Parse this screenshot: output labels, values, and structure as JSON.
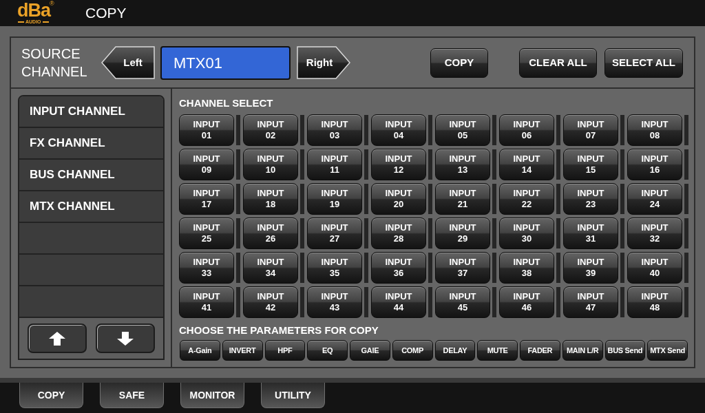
{
  "header": {
    "logo": {
      "text": "dBa",
      "mark": "®",
      "subtext": "AUDIO"
    },
    "title": "COPY"
  },
  "source": {
    "label": "SOURCE CHANNEL",
    "prev_button": "Left",
    "value": "MTX01",
    "next_button": "Right",
    "actions": [
      "COPY",
      "CLEAR ALL",
      "SELECT ALL"
    ]
  },
  "channel_types": [
    "INPUT CHANNEL",
    "FX CHANNEL",
    "BUS CHANNEL",
    "MTX CHANNEL"
  ],
  "channel_select": {
    "title": "CHANNEL SELECT",
    "channels": [
      {
        "label": "INPUT",
        "number": "01"
      },
      {
        "label": "INPUT",
        "number": "02"
      },
      {
        "label": "INPUT",
        "number": "03"
      },
      {
        "label": "INPUT",
        "number": "04"
      },
      {
        "label": "INPUT",
        "number": "05"
      },
      {
        "label": "INPUT",
        "number": "06"
      },
      {
        "label": "INPUT",
        "number": "07"
      },
      {
        "label": "INPUT",
        "number": "08"
      },
      {
        "label": "INPUT",
        "number": "09"
      },
      {
        "label": "INPUT",
        "number": "10"
      },
      {
        "label": "INPUT",
        "number": "11"
      },
      {
        "label": "INPUT",
        "number": "12"
      },
      {
        "label": "INPUT",
        "number": "13"
      },
      {
        "label": "INPUT",
        "number": "14"
      },
      {
        "label": "INPUT",
        "number": "15"
      },
      {
        "label": "INPUT",
        "number": "16"
      },
      {
        "label": "INPUT",
        "number": "17"
      },
      {
        "label": "INPUT",
        "number": "18"
      },
      {
        "label": "INPUT",
        "number": "19"
      },
      {
        "label": "INPUT",
        "number": "20"
      },
      {
        "label": "INPUT",
        "number": "21"
      },
      {
        "label": "INPUT",
        "number": "22"
      },
      {
        "label": "INPUT",
        "number": "23"
      },
      {
        "label": "INPUT",
        "number": "24"
      },
      {
        "label": "INPUT",
        "number": "25"
      },
      {
        "label": "INPUT",
        "number": "26"
      },
      {
        "label": "INPUT",
        "number": "27"
      },
      {
        "label": "INPUT",
        "number": "28"
      },
      {
        "label": "INPUT",
        "number": "29"
      },
      {
        "label": "INPUT",
        "number": "30"
      },
      {
        "label": "INPUT",
        "number": "31"
      },
      {
        "label": "INPUT",
        "number": "32"
      },
      {
        "label": "INPUT",
        "number": "33"
      },
      {
        "label": "INPUT",
        "number": "34"
      },
      {
        "label": "INPUT",
        "number": "35"
      },
      {
        "label": "INPUT",
        "number": "36"
      },
      {
        "label": "INPUT",
        "number": "37"
      },
      {
        "label": "INPUT",
        "number": "38"
      },
      {
        "label": "INPUT",
        "number": "39"
      },
      {
        "label": "INPUT",
        "number": "40"
      },
      {
        "label": "INPUT",
        "number": "41"
      },
      {
        "label": "INPUT",
        "number": "42"
      },
      {
        "label": "INPUT",
        "number": "43"
      },
      {
        "label": "INPUT",
        "number": "44"
      },
      {
        "label": "INPUT",
        "number": "45"
      },
      {
        "label": "INPUT",
        "number": "46"
      },
      {
        "label": "INPUT",
        "number": "47"
      },
      {
        "label": "INPUT",
        "number": "48"
      }
    ]
  },
  "parameters": {
    "title": "CHOOSE THE PARAMETERS FOR COPY",
    "items": [
      "A-Gain",
      "INVERT",
      "HPF",
      "EQ",
      "GAIE",
      "COMP",
      "DELAY",
      "MUTE",
      "FADER",
      "MAIN L/R",
      "BUS Send",
      "MTX Send"
    ]
  },
  "bottom_tabs": [
    "COPY",
    "SAFE",
    "MONITOR",
    "UTILITY"
  ]
}
